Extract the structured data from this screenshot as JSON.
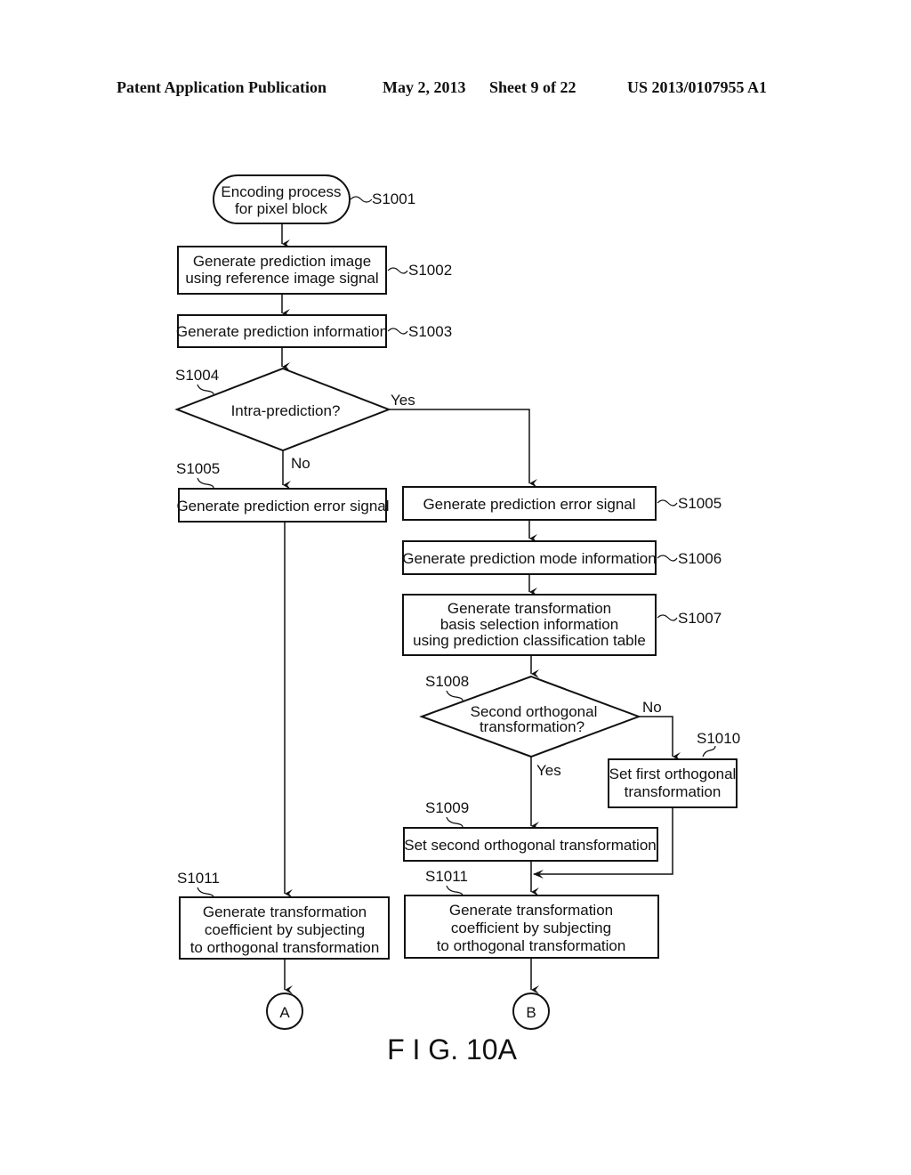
{
  "header": {
    "publication": "Patent Application Publication",
    "date": "May 2, 2013",
    "sheet": "Sheet 9 of 22",
    "number": "US 2013/0107955 A1"
  },
  "figure": {
    "caption": "F I G. 10A",
    "nodes": {
      "start": {
        "step": "S1001",
        "lines": [
          "Encoding process",
          "for pixel block"
        ]
      },
      "gen_pred_image": {
        "step": "S1002",
        "lines": [
          "Generate prediction image",
          "using reference image signal"
        ]
      },
      "gen_pred_info": {
        "step": "S1003",
        "lines": [
          "Generate prediction information"
        ]
      },
      "intra_decision": {
        "step": "S1004",
        "lines": [
          "Intra-prediction?"
        ],
        "yes": "Yes",
        "no": "No"
      },
      "left_error": {
        "step": "S1005",
        "lines": [
          "Generate prediction error signal"
        ]
      },
      "right_error": {
        "step": "S1005",
        "lines": [
          "Generate prediction error signal"
        ]
      },
      "pred_mode": {
        "step": "S1006",
        "lines": [
          "Generate prediction mode information"
        ]
      },
      "basis_select": {
        "step": "S1007",
        "lines": [
          "Generate transformation",
          "basis selection information",
          "using prediction classification table"
        ]
      },
      "second_decision": {
        "step": "S1008",
        "lines": [
          "Second orthogonal",
          "transformation?"
        ],
        "yes": "Yes",
        "no": "No"
      },
      "set_second": {
        "step": "S1009",
        "lines": [
          "Set second orthogonal transformation"
        ]
      },
      "set_first": {
        "step": "S1010",
        "lines": [
          "Set first orthogonal",
          "transformation"
        ]
      },
      "left_coeff": {
        "step": "S1011",
        "lines": [
          "Generate transformation",
          "coefficient by subjecting",
          "to orthogonal transformation"
        ]
      },
      "right_coeff": {
        "step": "S1011",
        "lines": [
          "Generate transformation",
          "coefficient by subjecting",
          "to orthogonal transformation"
        ]
      },
      "connector_a": {
        "label": "A"
      },
      "connector_b": {
        "label": "B"
      }
    }
  }
}
